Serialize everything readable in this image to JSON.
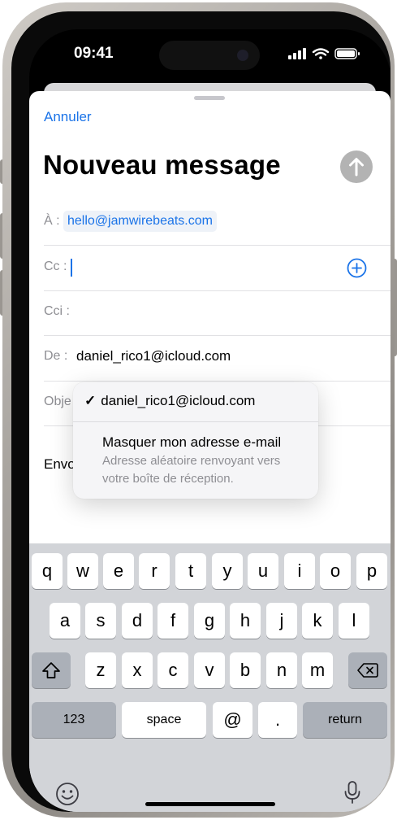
{
  "status_bar": {
    "time": "09:41"
  },
  "compose": {
    "cancel_label": "Annuler",
    "title": "Nouveau message",
    "to_label": "À :",
    "to_recipient": "hello@jamwirebeats.com",
    "cc_label": "Cc :",
    "cci_label": "Cci :",
    "from_label": "De :",
    "from_value": "daniel_rico1@icloud.com",
    "subject_label_partial": "Obje",
    "body_partial": "Envo"
  },
  "from_menu": {
    "check_mark": "✓",
    "selected": "daniel_rico1@icloud.com",
    "hide_email_title": "Masquer mon adresse e-mail",
    "hide_email_subtitle": "Adresse aléatoire renvoyant vers votre boîte de réception."
  },
  "keyboard": {
    "row1": [
      "q",
      "w",
      "e",
      "r",
      "t",
      "y",
      "u",
      "i",
      "o",
      "p"
    ],
    "row2": [
      "a",
      "s",
      "d",
      "f",
      "g",
      "h",
      "j",
      "k",
      "l"
    ],
    "row3": [
      "z",
      "x",
      "c",
      "v",
      "b",
      "n",
      "m"
    ],
    "numbers": "123",
    "space": "space",
    "at": "@",
    "dot": ".",
    "return": "return"
  },
  "colors": {
    "accent": "#1a73e8",
    "send_disabled": "#b3b3b3",
    "keyboard_bg": "#d2d4d8"
  },
  "icons": [
    "signal-icon",
    "wifi-icon",
    "battery-icon",
    "send-arrow-icon",
    "add-contact-icon",
    "shift-icon",
    "backspace-icon",
    "emoji-icon",
    "microphone-icon"
  ]
}
